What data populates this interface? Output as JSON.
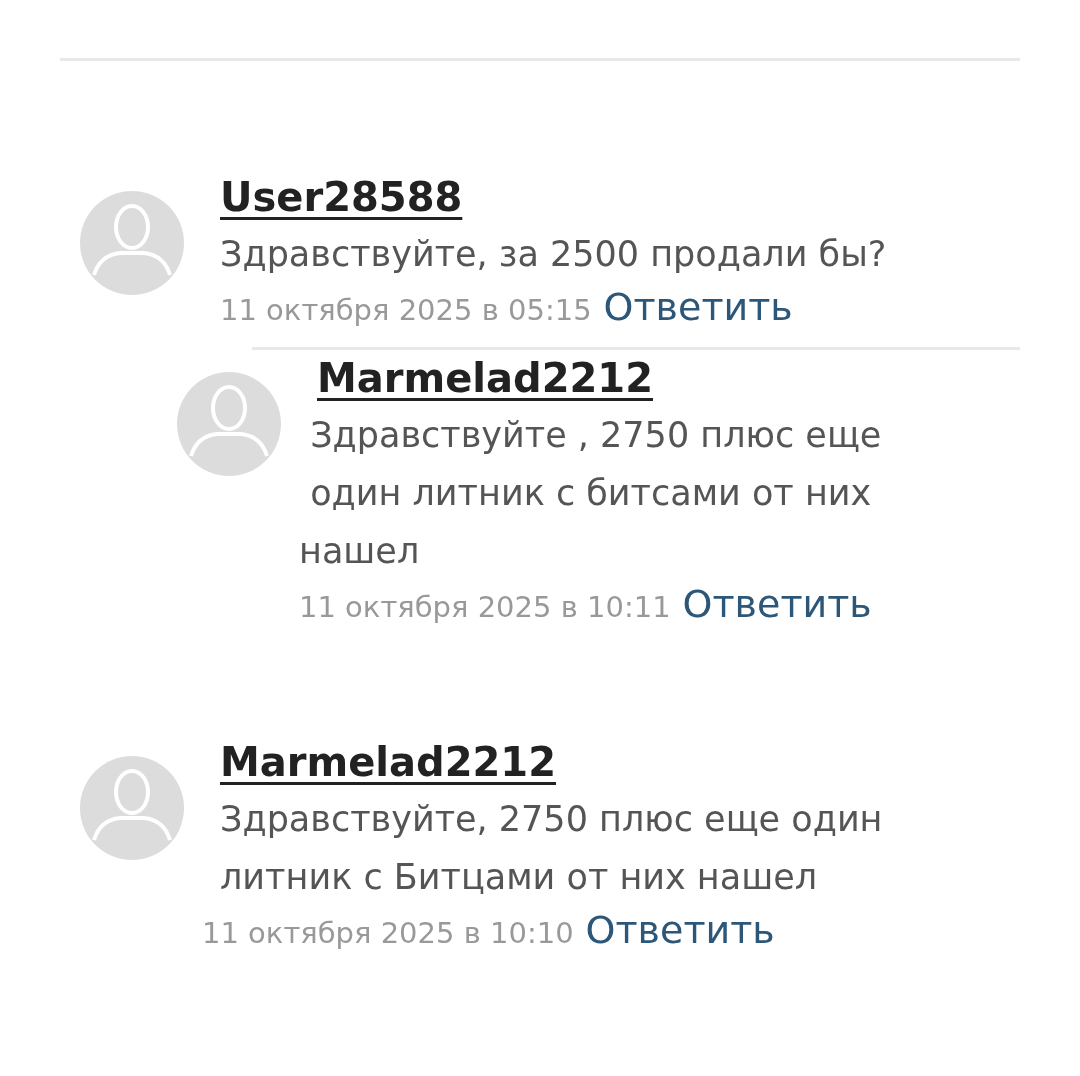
{
  "comments": [
    {
      "user": "User28588",
      "text": "Здравствуйте, за 2500 продали бы?",
      "date": "11 октября 2025 в 05:15",
      "reply": "Ответить",
      "children": [
        {
          "user": "Marmelad2212",
          "text": " Здравствуйте , 2750 плюс еще\n один литник с битсами от них\nнашел",
          "date": "11 октября 2025 в 10:11",
          "reply": "Ответить"
        }
      ]
    },
    {
      "user": "Marmelad2212",
      "text": "Здравствуйте, 2750 плюс еще один\nлитник с Битцами от них нашел",
      "date": "11 октября 2025 в 10:10",
      "reply": "Ответить"
    }
  ]
}
